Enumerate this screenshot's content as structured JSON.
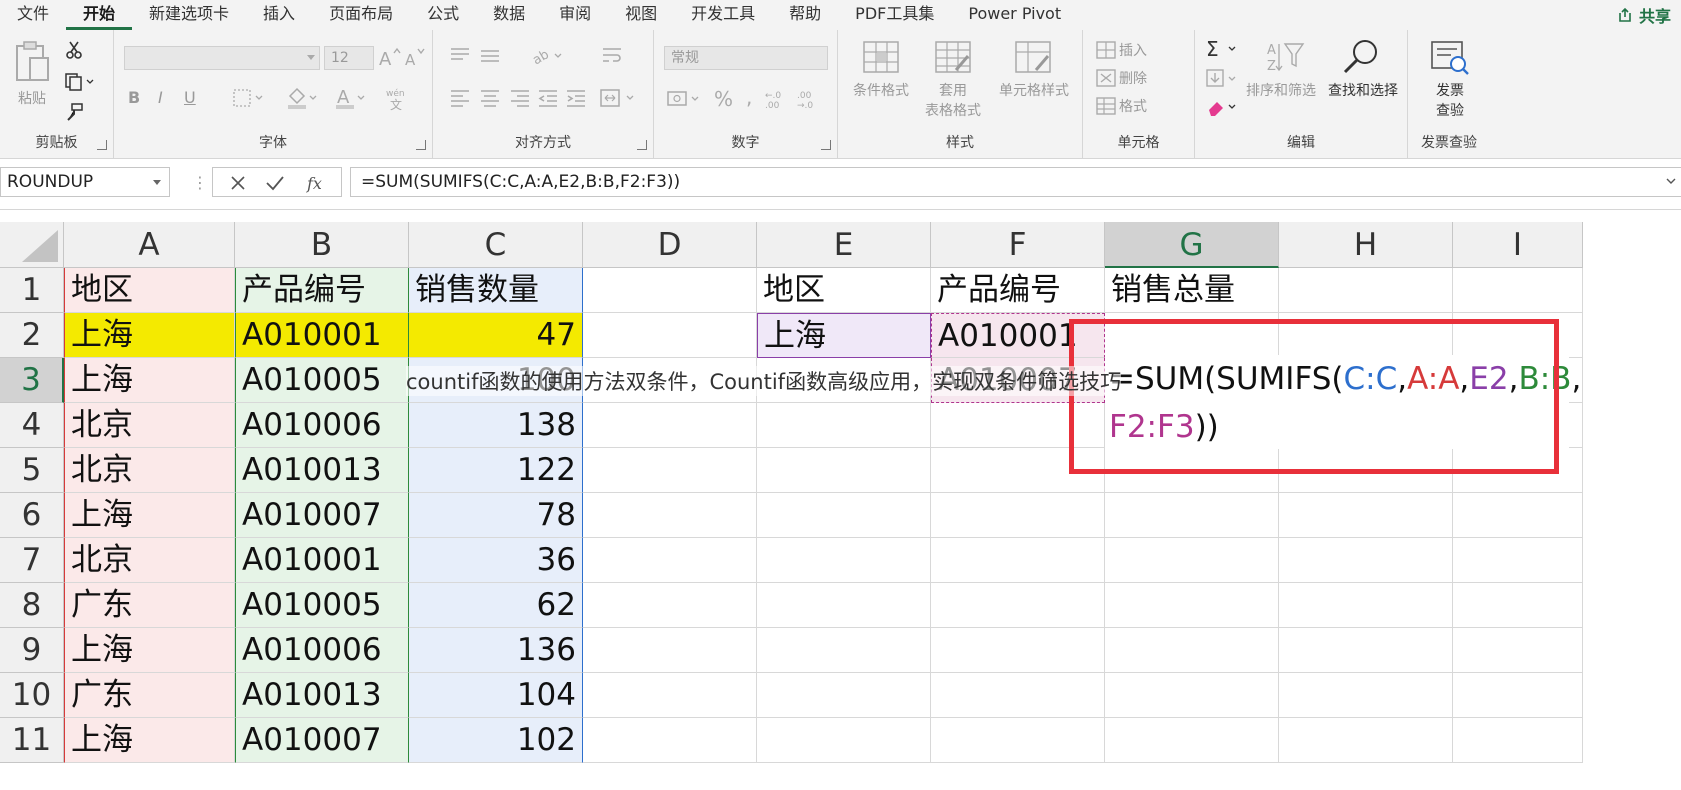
{
  "colors": {
    "accent": "#217346",
    "region_fill": "#fbe9e9",
    "code_fill": "#e6f4e7",
    "qty_fill": "#e7eefa",
    "highlight": "#f4ea00",
    "lookup_fill": "#f0e8f8",
    "red_frame": "#e8303a",
    "ref_blue": "#2d6fcd",
    "ref_red": "#d63a3a",
    "ref_purple": "#8a3fa8",
    "ref_green": "#2d8a3a",
    "ref_magenta": "#b0358e"
  },
  "ribbon": {
    "tabs": [
      "文件",
      "开始",
      "新建选项卡",
      "插入",
      "页面布局",
      "公式",
      "数据",
      "审阅",
      "视图",
      "开发工具",
      "帮助",
      "PDF工具集",
      "Power Pivot"
    ],
    "active_tab": "开始",
    "share_label": "共享",
    "share_icon": "share-icon",
    "groups": {
      "clipboard": {
        "label": "剪贴板",
        "paste": "粘贴"
      },
      "font": {
        "label": "字体",
        "font_size": "12",
        "bold": "B",
        "italic": "I",
        "underline": "U",
        "font_color_glyph": "A"
      },
      "alignment": {
        "label": "对齐方式"
      },
      "number": {
        "label": "数字",
        "format": "常规"
      },
      "styles": {
        "label": "样式",
        "cond_format": "条件格式",
        "table_format_1": "套用",
        "table_format_2": "表格格式",
        "cell_styles": "单元格样式"
      },
      "cells": {
        "label": "单元格",
        "insert": "插入",
        "delete": "删除",
        "format": "格式"
      },
      "editing": {
        "label": "编辑",
        "sort_filter": "排序和筛选",
        "find_select": "查找和选择"
      },
      "invoice": {
        "label": "发票查验",
        "btn_line1": "发票",
        "btn_line2": "查验"
      }
    }
  },
  "formula_bar": {
    "name_box": "ROUNDUP",
    "formula": "=SUM(SUMIFS(C:C,A:A,E2,B:B,F2:F3))"
  },
  "sheet": {
    "columns": [
      "A",
      "B",
      "C",
      "D",
      "E",
      "F",
      "G",
      "H",
      "I"
    ],
    "selected_column": "G",
    "selected_row": 3,
    "row_numbers": [
      "1",
      "2",
      "3",
      "4",
      "5",
      "6",
      "7",
      "8",
      "9",
      "10",
      "11"
    ],
    "rows": [
      [
        "地区",
        "产品编号",
        "销售数量",
        "",
        "地区",
        "产品编号",
        "销售总量",
        "",
        ""
      ],
      [
        "上海",
        "A010001",
        "47",
        "",
        "上海",
        "A010001",
        "",
        "",
        ""
      ],
      [
        "上海",
        "A010005",
        "100",
        "",
        "",
        "A010007",
        "",
        "",
        ""
      ],
      [
        "北京",
        "A010006",
        "138",
        "",
        "",
        "",
        "",
        "",
        ""
      ],
      [
        "北京",
        "A010013",
        "122",
        "",
        "",
        "",
        "",
        "",
        ""
      ],
      [
        "上海",
        "A010007",
        "78",
        "",
        "",
        "",
        "",
        "",
        ""
      ],
      [
        "北京",
        "A010001",
        "36",
        "",
        "",
        "",
        "",
        "",
        ""
      ],
      [
        "广东",
        "A010005",
        "62",
        "",
        "",
        "",
        "",
        "",
        ""
      ],
      [
        "上海",
        "A010006",
        "136",
        "",
        "",
        "",
        "",
        "",
        ""
      ],
      [
        "广东",
        "A010013",
        "104",
        "",
        "",
        "",
        "",
        "",
        ""
      ],
      [
        "上海",
        "A010007",
        "102",
        "",
        "",
        "",
        "",
        "",
        ""
      ]
    ],
    "editor_tokens": [
      {
        "t": "=SUM(SUMIFS(",
        "c": "#111111"
      },
      {
        "t": "C:C",
        "c": "#2d6fcd"
      },
      {
        "t": ",",
        "c": "#111111"
      },
      {
        "t": "A:A",
        "c": "#d63a3a"
      },
      {
        "t": ",",
        "c": "#111111"
      },
      {
        "t": "E2",
        "c": "#8a3fa8"
      },
      {
        "t": ",",
        "c": "#111111"
      },
      {
        "t": "B:B",
        "c": "#2d8a3a"
      },
      {
        "t": ",",
        "c": "#111111"
      }
    ],
    "editor_tokens_line2": [
      {
        "t": "F2:F3",
        "c": "#b0358e"
      },
      {
        "t": "))",
        "c": "#111111"
      }
    ]
  },
  "watermark": "countif函数的使用方法双条件，Countif函数高级应用，实现双条件筛选技巧"
}
